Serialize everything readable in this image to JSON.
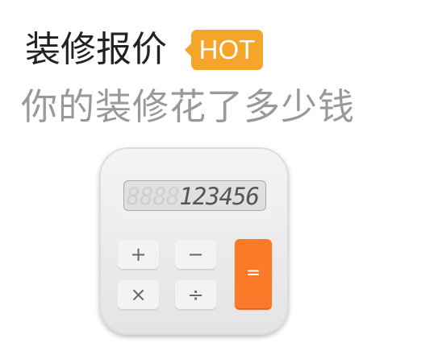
{
  "header": {
    "title": "装修报价",
    "badge": "HOT",
    "subtitle": "你的装修花了多少钱"
  },
  "calculator": {
    "display_ghost": "8888",
    "display_value": "123456",
    "keys": {
      "plus": "+",
      "minus": "−",
      "times": "×",
      "divide": "÷",
      "equals": "="
    }
  },
  "colors": {
    "badge": "#f5a52a",
    "equals_key": "#fb7a2a",
    "title": "#222222",
    "subtitle": "#999999"
  }
}
